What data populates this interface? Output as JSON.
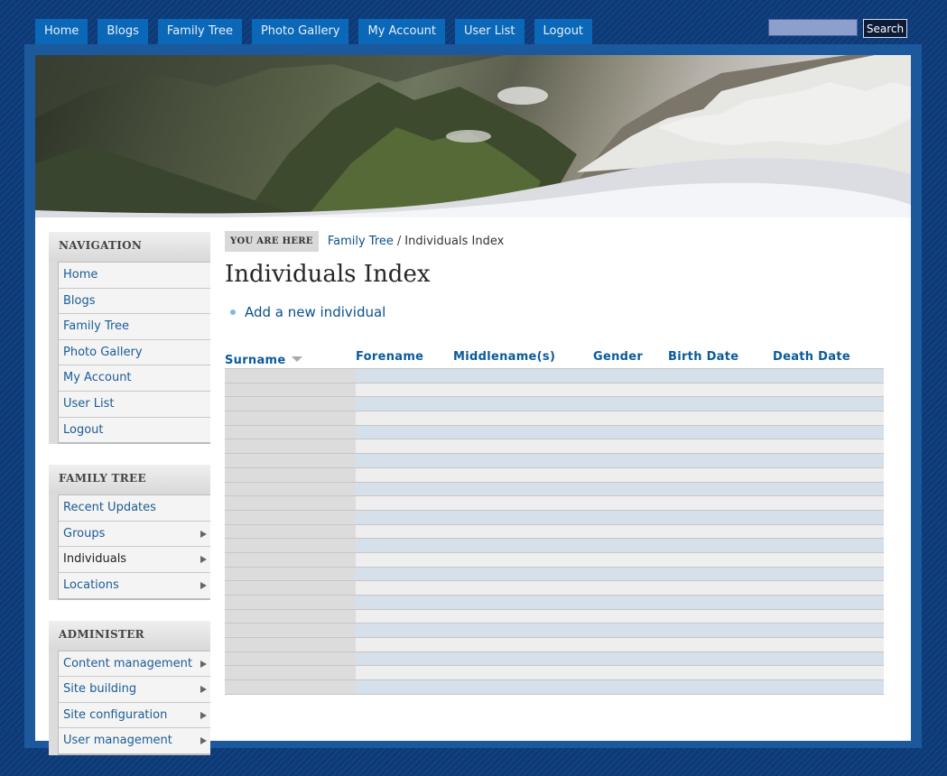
{
  "top_nav": [
    "Home",
    "Blogs",
    "Family Tree",
    "Photo Gallery",
    "My Account",
    "User List",
    "Logout"
  ],
  "search": {
    "value": "",
    "button_label": "Search"
  },
  "sidebar": {
    "navigation": {
      "title": "NAVIGATION",
      "items": [
        "Home",
        "Blogs",
        "Family Tree",
        "Photo Gallery",
        "My Account",
        "User List",
        "Logout"
      ]
    },
    "family_tree": {
      "title": "FAMILY TREE",
      "items": [
        "Recent Updates",
        "Groups",
        "Individuals",
        "Locations"
      ],
      "active": "Individuals"
    },
    "administer": {
      "title": "ADMINISTER",
      "items": [
        "Content management",
        "Site building",
        "Site configuration",
        "User management"
      ]
    }
  },
  "breadcrumb": {
    "label": "YOU ARE HERE",
    "link": "Family Tree",
    "separator": "/",
    "current": "Individuals Index"
  },
  "page_title": "Individuals Index",
  "add_link": "Add a new individual",
  "table": {
    "columns": [
      "Surname",
      "Forename",
      "Middlename(s)",
      "Gender",
      "Birth Date",
      "Death Date"
    ],
    "sorted_column": "Surname",
    "empty_row_count": 23
  },
  "colors": {
    "background": "#0c3a78",
    "tab": "#0b68b8",
    "link": "#1c5b96",
    "row_odd": "#d5e0ea",
    "row_even": "#eeeeee"
  }
}
